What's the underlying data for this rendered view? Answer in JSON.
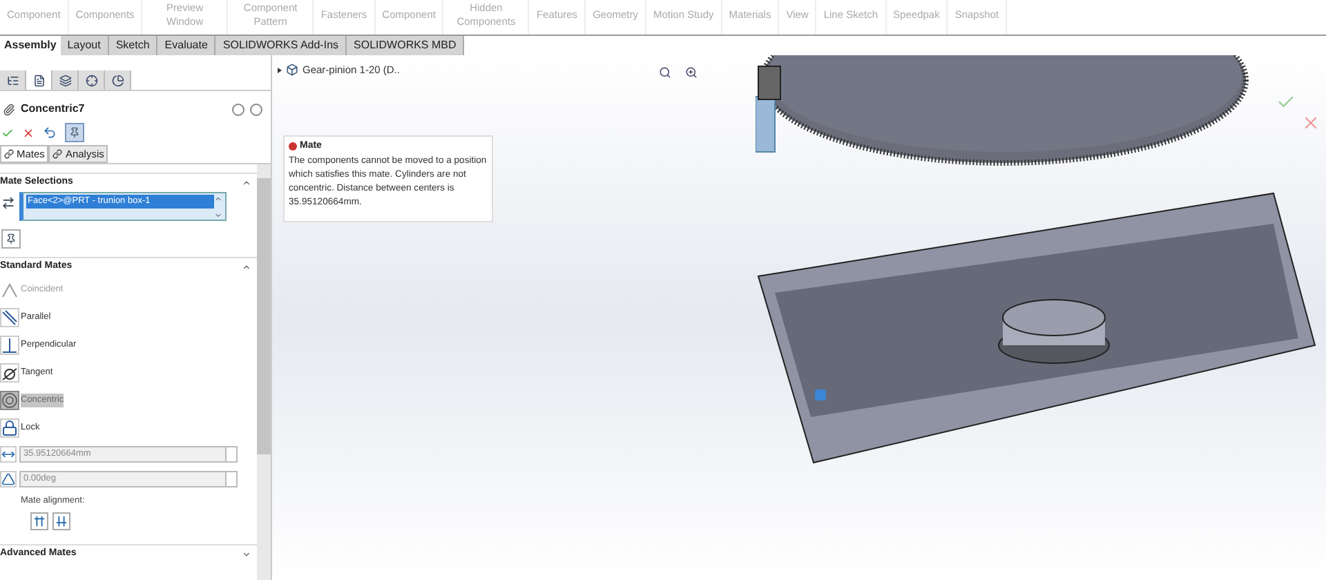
{
  "ribbon": [
    {
      "label": "Component"
    },
    {
      "label": "Components"
    },
    {
      "label": "Preview Window"
    },
    {
      "label": "Component Pattern"
    },
    {
      "label": "Fasteners"
    },
    {
      "label": "Component"
    },
    {
      "label": "Hidden Components"
    },
    {
      "label": "Features"
    },
    {
      "label": "Geometry"
    },
    {
      "label": "Motion Study"
    },
    {
      "label": "Materials"
    },
    {
      "label": "View"
    },
    {
      "label": "Line Sketch"
    },
    {
      "label": "Speedpak"
    },
    {
      "label": "Snapshot"
    }
  ],
  "tabs": [
    {
      "label": "Assembly",
      "selected": true
    },
    {
      "label": "Layout",
      "selected": false
    },
    {
      "label": "Sketch",
      "selected": false
    },
    {
      "label": "Evaluate",
      "selected": false
    },
    {
      "label": "SOLIDWORKS Add-Ins",
      "selected": false
    },
    {
      "label": "SOLIDWORKS MBD",
      "selected": false
    }
  ],
  "panel_tabs": [
    {
      "kind": "feature",
      "selected": false
    },
    {
      "kind": "property",
      "selected": true
    },
    {
      "kind": "config",
      "selected": false
    },
    {
      "kind": "dimxpert",
      "selected": false
    },
    {
      "kind": "display",
      "selected": false
    }
  ],
  "property_manager": {
    "title": "Concentric7",
    "pin": {
      "selected": true
    },
    "subtabs": [
      {
        "label": "Mates",
        "selected": true
      },
      {
        "label": "Analysis",
        "selected": false
      }
    ],
    "mate_selections": {
      "title": "Mate Selections",
      "items": [
        {
          "label": "Face<2>@PRT - trunion box-1",
          "selected": true
        }
      ]
    },
    "standard_mates": {
      "title": "Standard Mates",
      "items": [
        {
          "kind": "coincident",
          "label": "Coincident",
          "selected": false,
          "disabled": true
        },
        {
          "kind": "parallel",
          "label": "Parallel",
          "selected": false,
          "disabled": false
        },
        {
          "kind": "perpendicular",
          "label": "Perpendicular",
          "selected": false,
          "disabled": false
        },
        {
          "kind": "tangent",
          "label": "Tangent",
          "selected": false,
          "disabled": false
        },
        {
          "kind": "concentric",
          "label": "Concentric",
          "selected": true,
          "disabled": false
        },
        {
          "kind": "lock",
          "label": "Lock",
          "selected": false,
          "disabled": false
        }
      ],
      "distance": "35.95120664mm",
      "angle": "0.00deg",
      "alignment_label": "Mate alignment:"
    },
    "advanced_mates": {
      "title": "Advanced Mates",
      "expanded": false
    }
  },
  "tree_item": "Gear-pinion 1-20 (D..",
  "tooltip": {
    "title": "Mate",
    "message": "The components cannot be moved to a position which satisfies this mate. Cylinders are not concentric.  Distance between centers is 35.95120664mm."
  }
}
